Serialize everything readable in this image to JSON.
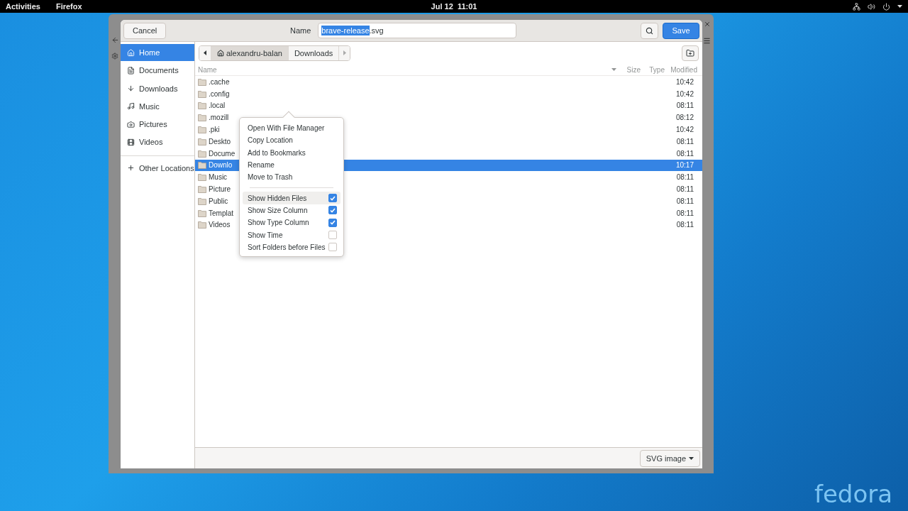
{
  "top_bar": {
    "activities": "Activities",
    "app_menu": "Firefox",
    "clock": "Jul 12  11:01"
  },
  "dialog": {
    "cancel": "Cancel",
    "name_label": "Name",
    "name_field": {
      "selected_part": "brave-release",
      "rest": ".svg"
    },
    "save": "Save"
  },
  "sidebar": {
    "items": [
      {
        "label": "Home",
        "kind": "home",
        "selected": true
      },
      {
        "label": "Documents",
        "kind": "documents",
        "selected": false
      },
      {
        "label": "Downloads",
        "kind": "downloads",
        "selected": false
      },
      {
        "label": "Music",
        "kind": "music",
        "selected": false
      },
      {
        "label": "Pictures",
        "kind": "pictures",
        "selected": false
      },
      {
        "label": "Videos",
        "kind": "videos",
        "selected": false
      }
    ],
    "other": "Other Locations"
  },
  "path_bar": [
    {
      "label": "alexandru-balan",
      "kind": "home",
      "selected": true
    },
    {
      "label": "Downloads",
      "kind": "folder",
      "selected": false
    }
  ],
  "columns": {
    "name": "Name",
    "size": "Size",
    "type": "Type",
    "modified": "Modified"
  },
  "rows": [
    {
      "name": ".cache",
      "modified": "10:42",
      "selected": false
    },
    {
      "name": ".config",
      "modified": "10:42",
      "selected": false
    },
    {
      "name": ".local",
      "modified": "08:11",
      "selected": false
    },
    {
      "name": ".mozill",
      "modified": "08:12",
      "selected": false
    },
    {
      "name": ".pki",
      "modified": "10:42",
      "selected": false
    },
    {
      "name": "Deskto",
      "modified": "08:11",
      "selected": false
    },
    {
      "name": "Docume",
      "modified": "08:11",
      "selected": false
    },
    {
      "name": "Downlo",
      "modified": "10:17",
      "selected": true
    },
    {
      "name": "Music",
      "modified": "08:11",
      "selected": false
    },
    {
      "name": "Picture",
      "modified": "08:11",
      "selected": false
    },
    {
      "name": "Public",
      "modified": "08:11",
      "selected": false
    },
    {
      "name": "Templat",
      "modified": "08:11",
      "selected": false
    },
    {
      "name": "Videos",
      "modified": "08:11",
      "selected": false
    }
  ],
  "context_menu": {
    "actions": [
      "Open With File Manager",
      "Copy Location",
      "Add to Bookmarks",
      "Rename",
      "Move to Trash"
    ],
    "toggles": [
      {
        "label": "Show Hidden Files",
        "checked": true,
        "hovered": true
      },
      {
        "label": "Show Size Column",
        "checked": true,
        "hovered": false
      },
      {
        "label": "Show Type Column",
        "checked": true,
        "hovered": false
      },
      {
        "label": "Show Time",
        "checked": false,
        "hovered": false
      },
      {
        "label": "Sort Folders before Files",
        "checked": false,
        "hovered": false
      }
    ]
  },
  "filter": "SVG image",
  "wallpaper_logo": "fedora"
}
